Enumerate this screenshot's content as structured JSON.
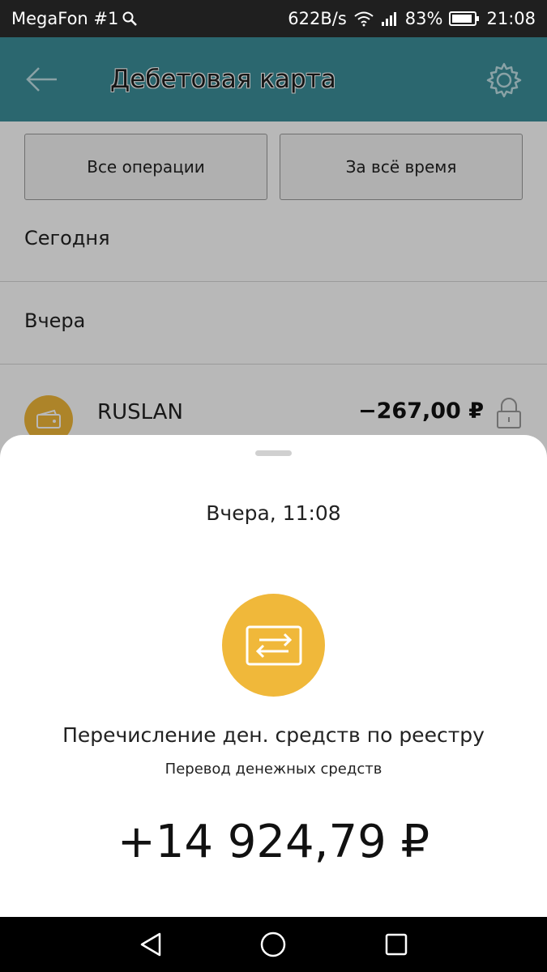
{
  "status_bar": {
    "carrier": "MegaFon #1",
    "speed": "622B/s",
    "battery": "83%",
    "time": "21:08"
  },
  "app_bar": {
    "title": "Дебетовая карта"
  },
  "filters": {
    "operations": "Все операции",
    "period": "За всё время"
  },
  "sections": {
    "today": "Сегодня",
    "yesterday": "Вчера"
  },
  "operation": {
    "name": "RUSLAN",
    "amount": "−267,00 ₽"
  },
  "sheet": {
    "date": "Вчера, 11:08",
    "description": "Перечисление ден. средств по реестру",
    "subtitle": "Перевод денежных средств",
    "amount": "+14 924,79 ₽"
  },
  "colors": {
    "accent": "#f0b83a",
    "app_bar": "#3c8f9a",
    "status_bar": "#1f1f1f"
  },
  "icons": {
    "back": "arrow-left-icon",
    "settings": "gear-icon",
    "lock": "lock-icon",
    "transfer": "transfer-card-icon",
    "wallet": "wallet-icon"
  }
}
